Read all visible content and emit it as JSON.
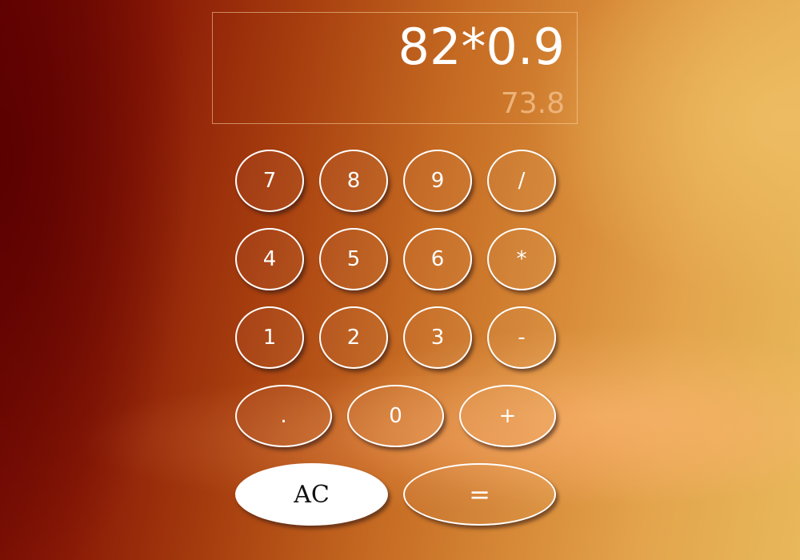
{
  "display": {
    "expression": "82*0.9",
    "result": "73.8"
  },
  "keypad": {
    "rows": [
      [
        "7",
        "8",
        "9",
        "/"
      ],
      [
        "4",
        "5",
        "6",
        "*"
      ],
      [
        "1",
        "2",
        "3",
        "-"
      ],
      [
        ".",
        "0",
        "+"
      ],
      [
        "AC",
        "="
      ]
    ]
  },
  "colors": {
    "key_border": "#ffffff",
    "ac_background": "#ffffff",
    "ac_text": "#111111",
    "result_text": "#f0b982"
  }
}
